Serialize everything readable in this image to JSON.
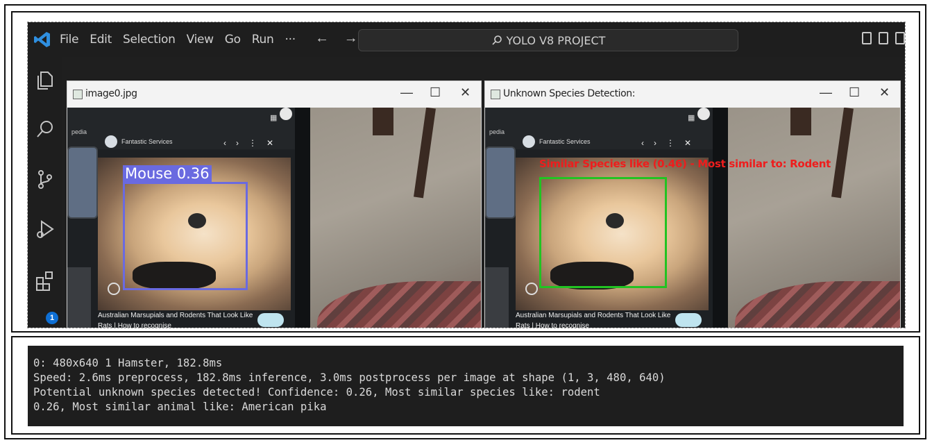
{
  "vscode": {
    "menu": [
      "File",
      "Edit",
      "Selection",
      "View",
      "Go",
      "Run",
      "···"
    ],
    "nav": {
      "back": "←",
      "forward": "→"
    },
    "search": {
      "text": "YOLO V8 PROJECT",
      "icon": "search-icon"
    },
    "activity_badge": "1",
    "activity_icons": [
      "explorer-icon",
      "search-icon",
      "source-control-icon",
      "run-debug-icon",
      "extensions-icon"
    ]
  },
  "window_left": {
    "title": "image0.jpg",
    "controls": {
      "minimize": "—",
      "maximize": "☐",
      "close": "✕"
    },
    "video": {
      "channel": "Fantastic Services",
      "caption": "Australian Marsupials and Rodents That Look Like Rats | How to recognise",
      "side_label": "pedia"
    },
    "detection": {
      "label": "Mouse 0.36",
      "color": "#6a6ae0"
    }
  },
  "window_right": {
    "title": "Unknown Species Detection:",
    "controls": {
      "minimize": "—",
      "maximize": "☐",
      "close": "✕"
    },
    "video": {
      "channel": "Fantastic Services",
      "caption": "Australian Marsupials and Rodents That Look Like Rats | How to recognise",
      "side_label": "pedia"
    },
    "detection": {
      "label": "Similar Species like (0.46) - Most similar to: Rodent",
      "box_color": "#22c322",
      "text_color": "#ee1d1d"
    }
  },
  "terminal": {
    "lines": [
      "0: 480x640 1 Hamster, 182.8ms",
      "Speed: 2.6ms preprocess, 182.8ms inference, 3.0ms postprocess per image at shape (1, 3, 480, 640)",
      "Potential unknown species detected! Confidence: 0.26, Most similar species like: rodent",
      "0.26, Most similar animal like: American pika"
    ]
  }
}
